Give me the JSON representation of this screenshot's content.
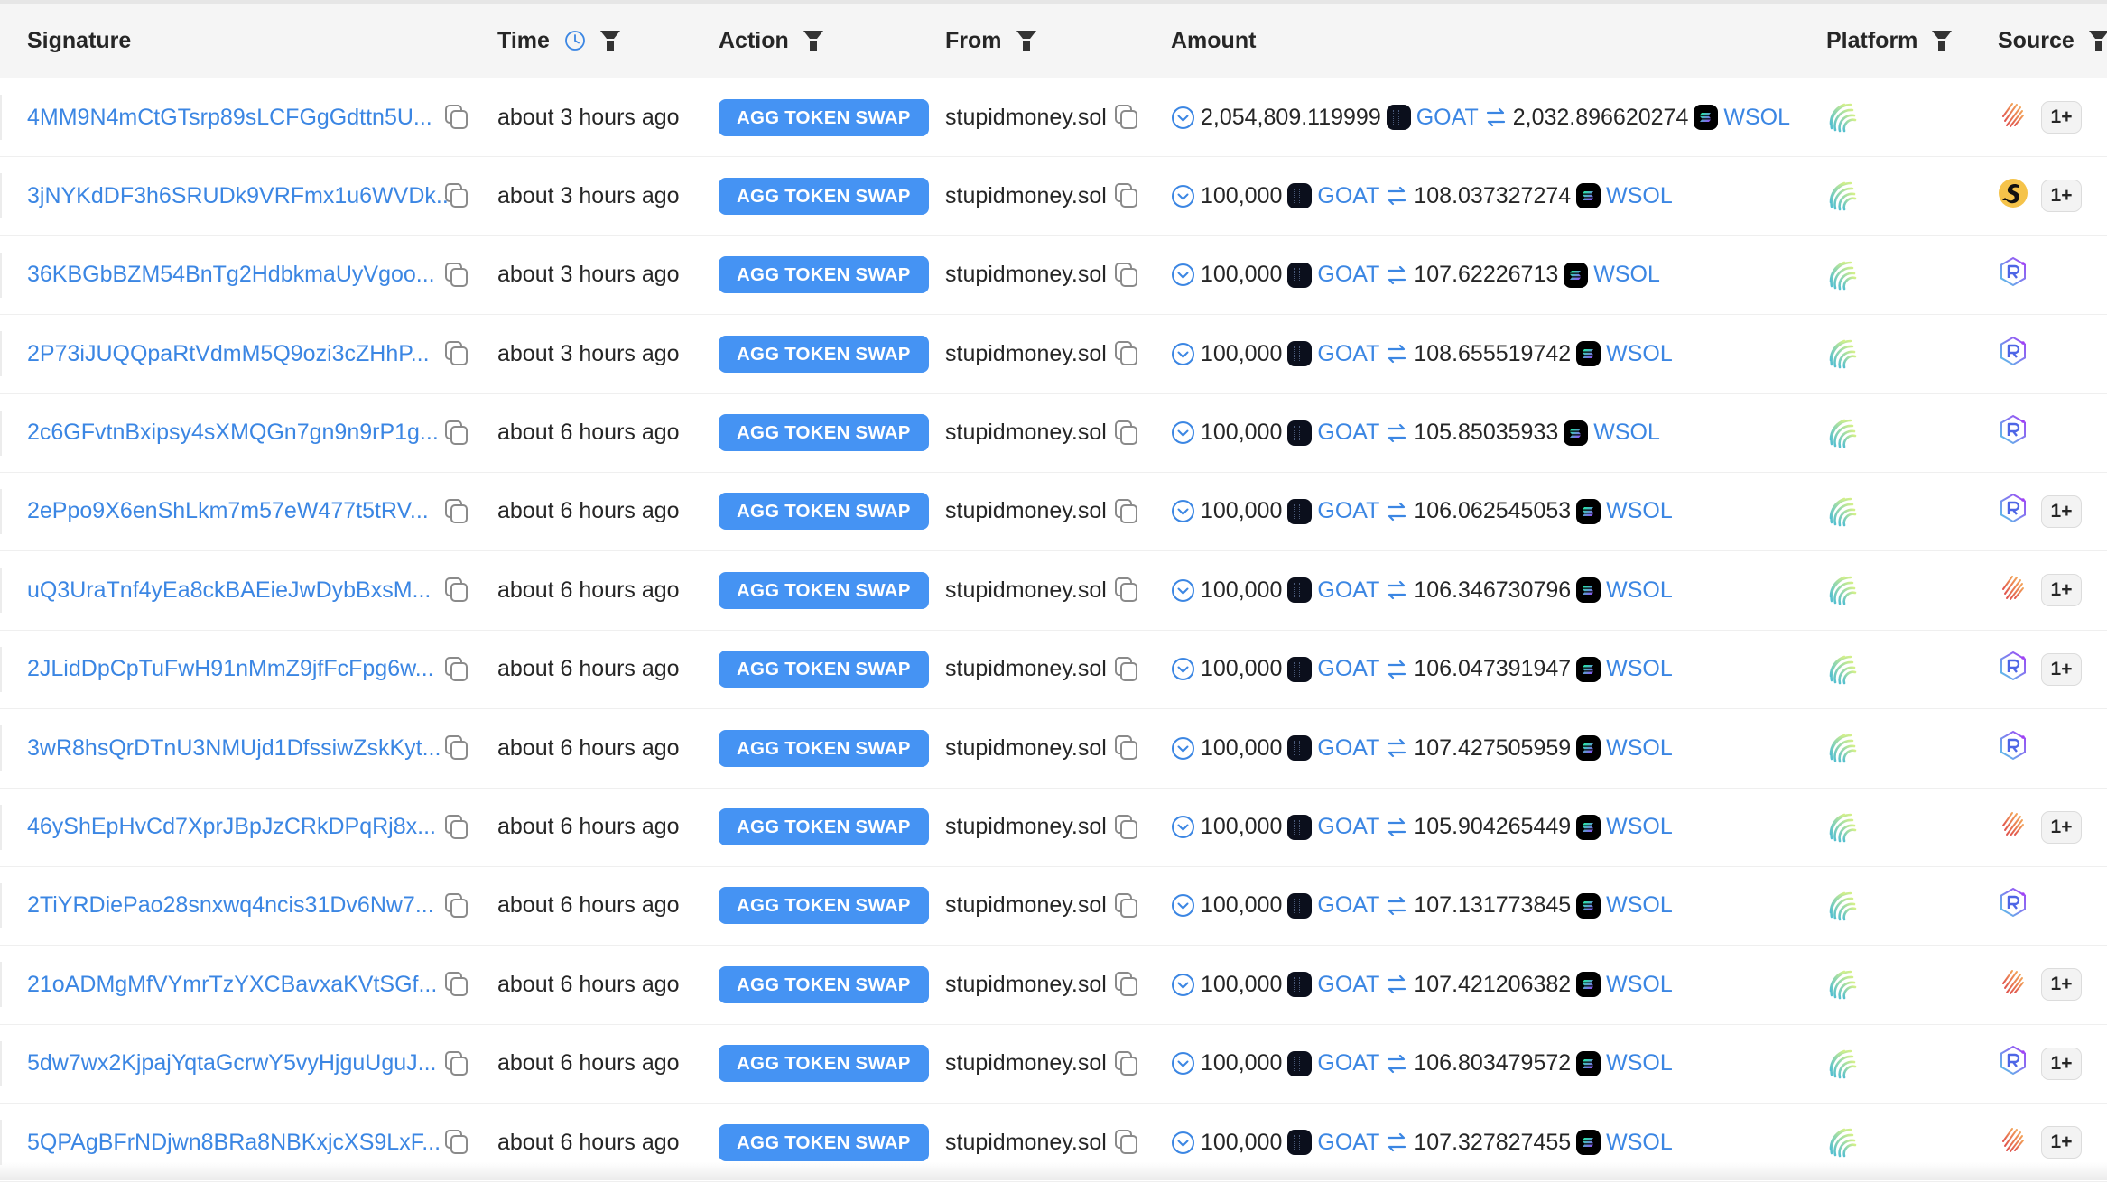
{
  "header": {
    "columns": [
      {
        "label": "Signature"
      },
      {
        "label": "Time"
      },
      {
        "label": "Action"
      },
      {
        "label": "From"
      },
      {
        "label": "Amount"
      },
      {
        "label": "Platform"
      },
      {
        "label": "Source"
      }
    ]
  },
  "colors": {
    "link": "#3b86e3",
    "badge": "#4593f3",
    "header_bg": "#f5f5f5"
  },
  "rows": [
    {
      "signature": "4MM9N4mCtGTsrp89sLCFGgGdttn5U...",
      "time": "about 3 hours ago",
      "action": "AGG TOKEN SWAP",
      "from": "stupidmoney.sol",
      "amount_in": "2,054,809.119999",
      "token_in": "GOAT",
      "amount_out": "2,032.896620274",
      "token_out": "WSOL",
      "platform": "platform-stripes-icon",
      "source": "orange-stripes-icon",
      "extra": "1+"
    },
    {
      "signature": "3jNYKdDF3h6SRUDk9VRFmx1u6WVDk...",
      "time": "about 3 hours ago",
      "action": "AGG TOKEN SWAP",
      "from": "stupidmoney.sol",
      "amount_in": "100,000",
      "token_in": "GOAT",
      "amount_out": "108.037327274",
      "token_out": "WSOL",
      "platform": "platform-stripes-icon",
      "source": "orca-icon",
      "extra": "1+"
    },
    {
      "signature": "36KBGbBZM54BnTg2HdbkmaUyVgoo...",
      "time": "about 3 hours ago",
      "action": "AGG TOKEN SWAP",
      "from": "stupidmoney.sol",
      "amount_in": "100,000",
      "token_in": "GOAT",
      "amount_out": "107.62226713",
      "token_out": "WSOL",
      "platform": "platform-stripes-icon",
      "source": "raydium-icon",
      "extra": ""
    },
    {
      "signature": "2P73iJUQQpaRtVdmM5Q9ozi3cZHhP...",
      "time": "about 3 hours ago",
      "action": "AGG TOKEN SWAP",
      "from": "stupidmoney.sol",
      "amount_in": "100,000",
      "token_in": "GOAT",
      "amount_out": "108.655519742",
      "token_out": "WSOL",
      "platform": "platform-stripes-icon",
      "source": "raydium-icon",
      "extra": ""
    },
    {
      "signature": "2c6GFvtnBxipsy4sXMQGn7gn9n9rP1g...",
      "time": "about 6 hours ago",
      "action": "AGG TOKEN SWAP",
      "from": "stupidmoney.sol",
      "amount_in": "100,000",
      "token_in": "GOAT",
      "amount_out": "105.85035933",
      "token_out": "WSOL",
      "platform": "platform-stripes-icon",
      "source": "raydium-icon",
      "extra": ""
    },
    {
      "signature": "2ePpo9X6enShLkm7m57eW477t5tRV...",
      "time": "about 6 hours ago",
      "action": "AGG TOKEN SWAP",
      "from": "stupidmoney.sol",
      "amount_in": "100,000",
      "token_in": "GOAT",
      "amount_out": "106.062545053",
      "token_out": "WSOL",
      "platform": "platform-stripes-icon",
      "source": "raydium-icon",
      "extra": "1+"
    },
    {
      "signature": "uQ3UraTnf4yEa8ckBAEieJwDybBxsM...",
      "time": "about 6 hours ago",
      "action": "AGG TOKEN SWAP",
      "from": "stupidmoney.sol",
      "amount_in": "100,000",
      "token_in": "GOAT",
      "amount_out": "106.346730796",
      "token_out": "WSOL",
      "platform": "platform-stripes-icon",
      "source": "orange-stripes-icon",
      "extra": "1+"
    },
    {
      "signature": "2JLidDpCpTuFwH91nMmZ9jfFcFpg6w...",
      "time": "about 6 hours ago",
      "action": "AGG TOKEN SWAP",
      "from": "stupidmoney.sol",
      "amount_in": "100,000",
      "token_in": "GOAT",
      "amount_out": "106.047391947",
      "token_out": "WSOL",
      "platform": "platform-stripes-icon",
      "source": "raydium-icon",
      "extra": "1+"
    },
    {
      "signature": "3wR8hsQrDTnU3NMUjd1DfssiwZskKyt...",
      "time": "about 6 hours ago",
      "action": "AGG TOKEN SWAP",
      "from": "stupidmoney.sol",
      "amount_in": "100,000",
      "token_in": "GOAT",
      "amount_out": "107.427505959",
      "token_out": "WSOL",
      "platform": "platform-stripes-icon",
      "source": "raydium-icon",
      "extra": ""
    },
    {
      "signature": "46yShEpHvCd7XprJBpJzCRkDPqRj8x...",
      "time": "about 6 hours ago",
      "action": "AGG TOKEN SWAP",
      "from": "stupidmoney.sol",
      "amount_in": "100,000",
      "token_in": "GOAT",
      "amount_out": "105.904265449",
      "token_out": "WSOL",
      "platform": "platform-stripes-icon",
      "source": "orange-stripes-icon",
      "extra": "1+"
    },
    {
      "signature": "2TiYRDiePao28snxwq4ncis31Dv6Nw7...",
      "time": "about 6 hours ago",
      "action": "AGG TOKEN SWAP",
      "from": "stupidmoney.sol",
      "amount_in": "100,000",
      "token_in": "GOAT",
      "amount_out": "107.131773845",
      "token_out": "WSOL",
      "platform": "platform-stripes-icon",
      "source": "raydium-icon",
      "extra": ""
    },
    {
      "signature": "21oADMgMfVYmrTzYXCBavxaKVtSGf...",
      "time": "about 6 hours ago",
      "action": "AGG TOKEN SWAP",
      "from": "stupidmoney.sol",
      "amount_in": "100,000",
      "token_in": "GOAT",
      "amount_out": "107.421206382",
      "token_out": "WSOL",
      "platform": "platform-stripes-icon",
      "source": "orange-stripes-icon",
      "extra": "1+"
    },
    {
      "signature": "5dw7wx2KjpajYqtaGcrwY5vyHjguUguJ...",
      "time": "about 6 hours ago",
      "action": "AGG TOKEN SWAP",
      "from": "stupidmoney.sol",
      "amount_in": "100,000",
      "token_in": "GOAT",
      "amount_out": "106.803479572",
      "token_out": "WSOL",
      "platform": "platform-stripes-icon",
      "source": "raydium-icon",
      "extra": "1+"
    },
    {
      "signature": "5QPAgBFrNDjwn8BRa8NBKxjcXS9LxF...",
      "time": "about 6 hours ago",
      "action": "AGG TOKEN SWAP",
      "from": "stupidmoney.sol",
      "amount_in": "100,000",
      "token_in": "GOAT",
      "amount_out": "107.327827455",
      "token_out": "WSOL",
      "platform": "platform-stripes-icon",
      "source": "orange-stripes-icon",
      "extra": "1+"
    }
  ]
}
